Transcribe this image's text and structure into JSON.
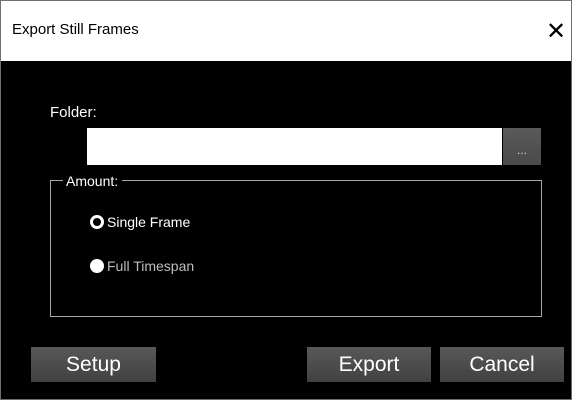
{
  "window": {
    "title": "Export Still Frames",
    "close_label": "✕"
  },
  "folder": {
    "label": "Folder:",
    "value": "",
    "browse_label": "..."
  },
  "amount": {
    "legend": "Amount:",
    "options": [
      {
        "label": "Single Frame",
        "selected": true,
        "enabled": true
      },
      {
        "label": "Full Timespan",
        "selected": false,
        "enabled": false
      }
    ]
  },
  "buttons": {
    "setup_label": "Setup",
    "export_label": "Export",
    "cancel_label": "Cancel"
  },
  "colors": {
    "background": "#000000",
    "titlebar": "#ffffff",
    "button": "#4d4d4d",
    "frame_border": "#a8a8a8",
    "disabled_text": "#bdbdbd"
  }
}
